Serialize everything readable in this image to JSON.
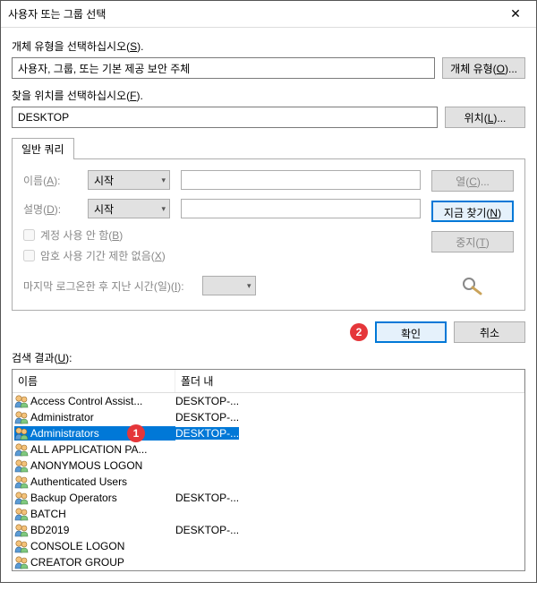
{
  "title": "사용자 또는 그룹 선택",
  "labels": {
    "objectTypeSection": "개체 유형을 선택하십시오",
    "objectTypeHotkey": "S",
    "objectTypeValue": "사용자, 그룹, 또는 기본 제공 보안 주체",
    "objectTypeBtn": "개체 유형",
    "objectTypeBtnHotkey": "O",
    "locationSection": "찾을 위치를 선택하십시오",
    "locationHotkey": "F",
    "locationValue": "DESKTOP",
    "locationBtn": "위치",
    "locationBtnHotkey": "L",
    "tab": "일반 쿼리",
    "nameLbl": "이름",
    "nameHotkey": "A",
    "descLbl": "설명",
    "descHotkey": "D",
    "comboStart": "시작",
    "chkDisabled": "계정 사용 안 함",
    "chkDisabledHotkey": "B",
    "chkNoExpire": "암호 사용 기간 제한 없음",
    "chkNoExpireHotkey": "X",
    "daysLbl": "마지막 로그온한 후 지난 시간(일)",
    "daysHotkey": "I",
    "columnsBtn": "열",
    "columnsHotkey": "C",
    "findNowBtn": "지금 찾기",
    "findNowHotkey": "N",
    "stopBtn": "중지",
    "stopHotkey": "T",
    "okBtn": "확인",
    "cancelBtn": "취소",
    "resultsLbl": "검색 결과",
    "resultsHotkey": "U",
    "colName": "이름",
    "colFolder": "폴더 내"
  },
  "markers": {
    "one": "1",
    "two": "2"
  },
  "results": [
    {
      "name": "Access Control Assist...",
      "folder": "DESKTOP-...",
      "selected": false
    },
    {
      "name": "Administrator",
      "folder": "DESKTOP-...",
      "selected": false
    },
    {
      "name": "Administrators",
      "folder": "DESKTOP-...",
      "selected": true,
      "marker": "1"
    },
    {
      "name": "ALL APPLICATION PA...",
      "folder": "",
      "selected": false
    },
    {
      "name": "ANONYMOUS LOGON",
      "folder": "",
      "selected": false
    },
    {
      "name": "Authenticated Users",
      "folder": "",
      "selected": false
    },
    {
      "name": "Backup Operators",
      "folder": "DESKTOP-...",
      "selected": false
    },
    {
      "name": "BATCH",
      "folder": "",
      "selected": false
    },
    {
      "name": "BD2019",
      "folder": "DESKTOP-...",
      "selected": false
    },
    {
      "name": "CONSOLE LOGON",
      "folder": "",
      "selected": false
    },
    {
      "name": "CREATOR GROUP",
      "folder": "",
      "selected": false
    }
  ]
}
